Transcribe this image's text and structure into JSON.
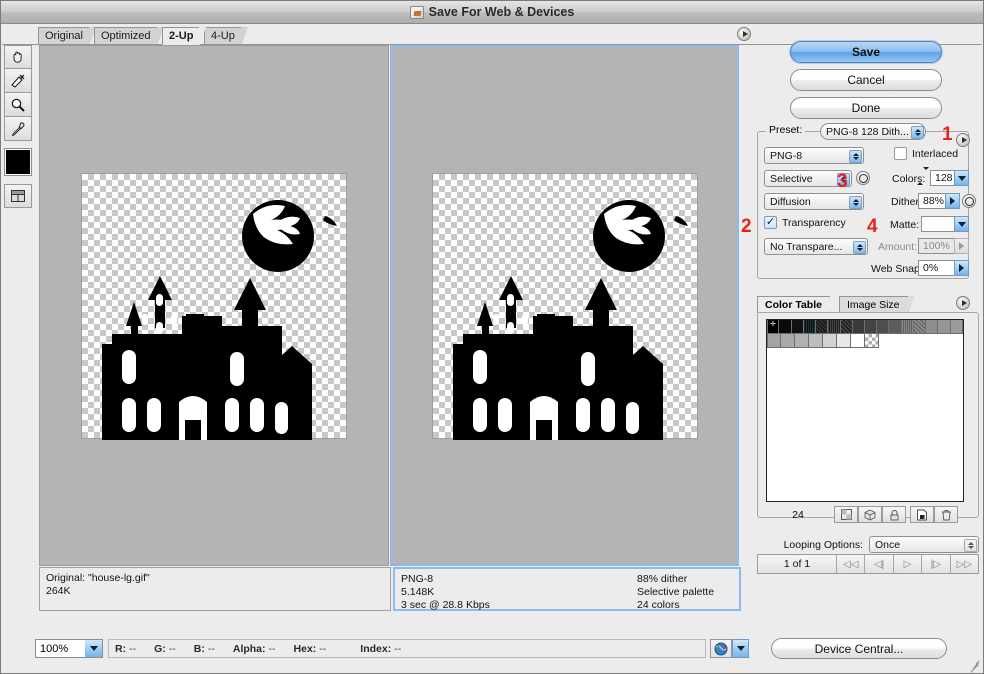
{
  "window": {
    "title": "Save For Web & Devices",
    "icon": "save-for-web-icon"
  },
  "tabs": [
    {
      "label": "Original",
      "active": false
    },
    {
      "label": "Optimized",
      "active": false
    },
    {
      "label": "2-Up",
      "active": true
    },
    {
      "label": "4-Up",
      "active": false
    }
  ],
  "toolbar": {
    "tools": [
      {
        "name": "hand-tool",
        "glyph": "✋"
      },
      {
        "name": "slice-select-tool",
        "glyph": "⌁"
      },
      {
        "name": "zoom-tool",
        "glyph": "🔍"
      },
      {
        "name": "eyedropper-tool",
        "glyph": "⚲"
      }
    ],
    "foreground_swatch": "#000000",
    "toggle_slices_name": "toggle-slices-visibility"
  },
  "panes": {
    "left": {
      "label": "Original pane",
      "info_line1": "Original: \"house-lg.gif\"",
      "info_line2": "264K"
    },
    "right": {
      "label": "Optimized pane",
      "info_left": [
        "PNG-8",
        "5.148K",
        "3 sec @ 28.8 Kbps"
      ],
      "info_right": [
        "88% dither",
        "Selective palette",
        "24 colors"
      ]
    }
  },
  "actions": {
    "save": "Save",
    "cancel": "Cancel",
    "done": "Done"
  },
  "settings": {
    "preset_legend": "Preset:",
    "preset_value": "PNG-8 128 Dith...",
    "format_value": "PNG-8",
    "palette_value": "Selective",
    "dither_algorithm_value": "Diffusion",
    "transparency_label": "Transparency",
    "transparency_checked": true,
    "transparency_dither_value": "No Transpare...",
    "interlaced_label": "Interlaced",
    "interlaced_checked": false,
    "colors_label": "Colors:",
    "colors_value": "128",
    "dither_label": "Dither:",
    "dither_value": "88%",
    "matte_label": "Matte:",
    "matte_value": "",
    "amount_label": "Amount:",
    "amount_value": "100%",
    "websnap_label": "Web Snap:",
    "websnap_value": "0%"
  },
  "annotations": [
    {
      "number": "1",
      "color": "#e8221b"
    },
    {
      "number": "2",
      "color": "#e8221b"
    },
    {
      "number": "3",
      "color": "#e8221b"
    },
    {
      "number": "4",
      "color": "#e8221b"
    }
  ],
  "color_table": {
    "tabs": [
      {
        "label": "Color Table",
        "active": true
      },
      {
        "label": "Image Size",
        "active": false
      }
    ],
    "count": "24",
    "swatches_row1": [
      "#000000",
      "#0a0a0a",
      "#111111",
      "#1d2424",
      "#2b2b2b",
      "#343434",
      "#3a3a3a",
      "#434343",
      "#4d4d4d",
      "#5c5c5c",
      "#6e6e6e",
      "#7c7c7c",
      "#8a8a8a",
      "#919191",
      "#989898",
      "#9e9e9e"
    ],
    "swatches_row2": [
      "#a5a5a5",
      "#ababab",
      "#b2b2b2",
      "#bfbfbf",
      "#d3d3d3",
      "#e6e6e6",
      "#ffffff",
      "transparent"
    ],
    "buttons": [
      {
        "name": "map-to-transparent-button",
        "glyph": "transparency-icon"
      },
      {
        "name": "map-to-web-safe-button",
        "glyph": "cube-icon"
      },
      {
        "name": "lock-color-button",
        "glyph": "lock-icon"
      },
      {
        "name": "new-color-button",
        "glyph": "new-page-icon"
      },
      {
        "name": "delete-color-button",
        "glyph": "trash-icon"
      }
    ]
  },
  "looping": {
    "label": "Looping Options:",
    "value": "Once"
  },
  "frame_nav": {
    "status": "1 of 1",
    "buttons": [
      {
        "name": "first-frame-button",
        "glyph": "◁◁"
      },
      {
        "name": "previous-frame-button",
        "glyph": "◁|"
      },
      {
        "name": "play-button",
        "glyph": "▷"
      },
      {
        "name": "next-frame-button",
        "glyph": "|▷"
      },
      {
        "name": "last-frame-button",
        "glyph": "▷▷"
      }
    ]
  },
  "statusbar": {
    "zoom": "100%",
    "readout": [
      {
        "key": "R:",
        "value": "--"
      },
      {
        "key": "G:",
        "value": "--"
      },
      {
        "key": "B:",
        "value": "--"
      },
      {
        "key": "Alpha:",
        "value": "--"
      },
      {
        "key": "Hex:",
        "value": "--"
      },
      {
        "key": "Index:",
        "value": "--"
      }
    ],
    "preview_in_browser_name": "preview-in-browser-icon",
    "device_central": "Device Central..."
  }
}
